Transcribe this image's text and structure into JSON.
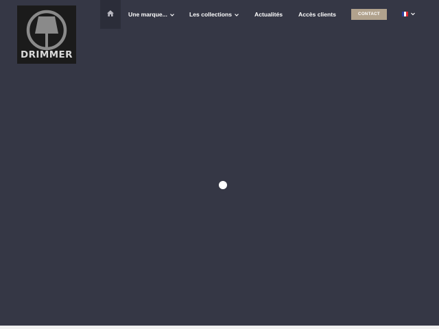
{
  "logo": {
    "text": "DRIMMER"
  },
  "nav": {
    "home_icon": "home-icon",
    "items": [
      {
        "label": "Une marque...",
        "has_dropdown": true
      },
      {
        "label": "Les collections",
        "has_dropdown": true
      },
      {
        "label": "Actualités",
        "has_dropdown": false
      },
      {
        "label": "Accès clients",
        "has_dropdown": false
      }
    ],
    "contact_label": "CONTACT",
    "language_icon": "french-flag-icon"
  },
  "colors": {
    "background": "#353745",
    "nav_active": "#2b2d39",
    "contact_button": "#b1a28d",
    "logo_bg": "#1b1b1b"
  }
}
